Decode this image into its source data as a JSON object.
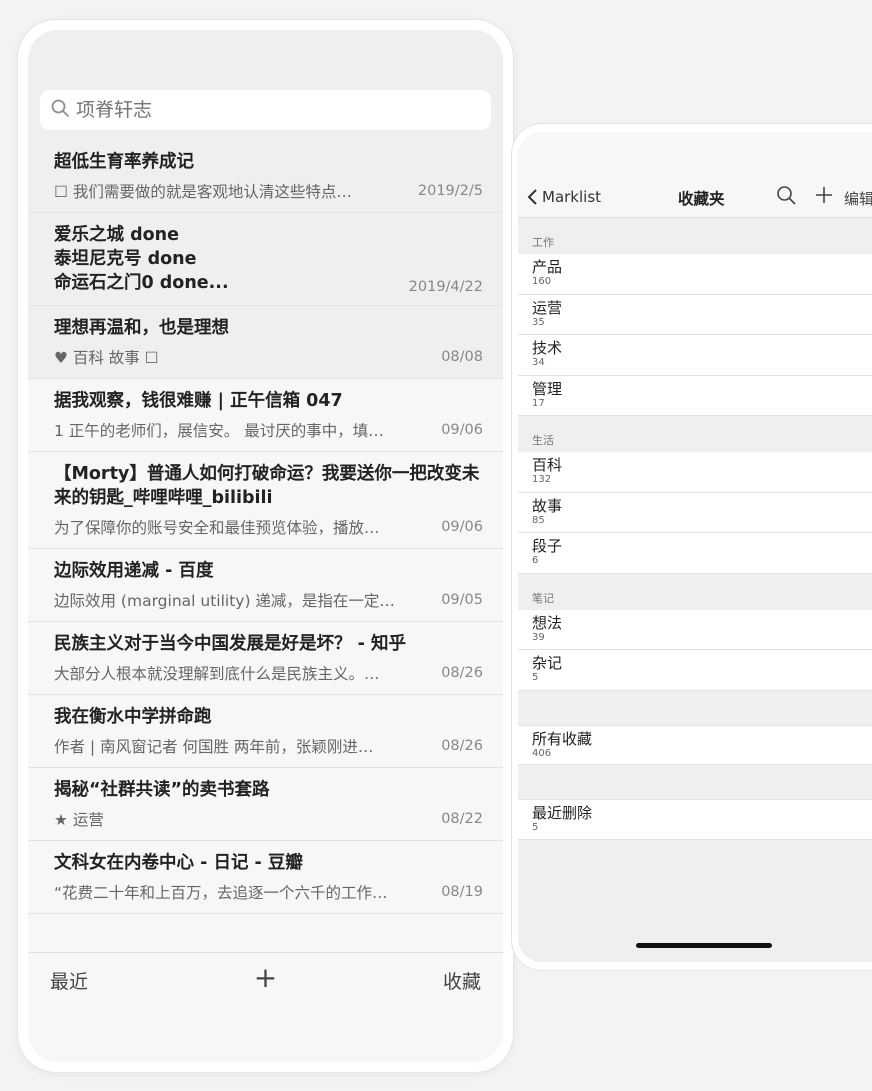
{
  "left": {
    "search_placeholder": "项脊轩志",
    "items": [
      {
        "title": "超低生育率养成记",
        "snippet": "☐ 我们需要做的就是客观地认清这些特点…",
        "date": "2019/2/5",
        "shaded": true
      },
      {
        "title": "爱乐之城 done\n泰坦尼克号 done\n命运石之门0 done...",
        "snippet": "",
        "date": "2019/4/22",
        "shaded": true
      },
      {
        "title": "理想再温和，也是理想",
        "snippet": "♥ 百科 故事 ☐",
        "date": "08/08",
        "shaded": true
      },
      {
        "title": "据我观察，钱很难赚 | 正午信箱 047",
        "snippet": "1 正午的老师们，展信安。 最讨厌的事中，填…",
        "date": "09/06",
        "shaded": false
      },
      {
        "title": "【Morty】普通人如何打破命运？我要送你一把改变未来的钥匙_哔哩哔哩_bilibili",
        "snippet": "为了保障你的账号安全和最佳预览体验，播放…",
        "date": "09/06",
        "shaded": false
      },
      {
        "title": "边际效用递减 - 百度",
        "snippet": "边际效用 (marginal utility) 递减，是指在一定…",
        "date": "09/05",
        "shaded": false
      },
      {
        "title": "民族主义对于当今中国发展是好是坏？ - 知乎",
        "snippet": "大部分人根本就没理解到底什么是民族主义。…",
        "date": "08/26",
        "shaded": false
      },
      {
        "title": "我在衡水中学拼命跑",
        "snippet": "作者 | 南风窗记者 何国胜 两年前，张颖刚进…",
        "date": "08/26",
        "shaded": false
      },
      {
        "title": "揭秘“社群共读”的卖书套路",
        "snippet": "★ 运营",
        "date": "08/22",
        "shaded": false
      },
      {
        "title": "文科女在内卷中心 - 日记 - 豆瓣",
        "snippet": "“花费二十年和上百万，去追逐一个六千的工作…",
        "date": "08/19",
        "shaded": false
      }
    ],
    "tabbar": {
      "recent": "最近",
      "add": "+",
      "favorites": "收藏"
    }
  },
  "right": {
    "back_label": "Marklist",
    "title": "收藏夹",
    "edit_label": "编辑",
    "sections": [
      {
        "header": "工作",
        "cells": [
          {
            "name": "产品",
            "count": "160"
          },
          {
            "name": "运营",
            "count": "35"
          },
          {
            "name": "技术",
            "count": "34"
          },
          {
            "name": "管理",
            "count": "17"
          }
        ]
      },
      {
        "header": "生活",
        "cells": [
          {
            "name": "百科",
            "count": "132"
          },
          {
            "name": "故事",
            "count": "85"
          },
          {
            "name": "段子",
            "count": "6"
          }
        ]
      },
      {
        "header": "笔记",
        "cells": [
          {
            "name": "想法",
            "count": "39"
          },
          {
            "name": "杂记",
            "count": "5"
          }
        ]
      }
    ],
    "all": {
      "name": "所有收藏",
      "count": "406"
    },
    "deleted": {
      "name": "最近删除",
      "count": "5"
    },
    "chevron": "›"
  }
}
